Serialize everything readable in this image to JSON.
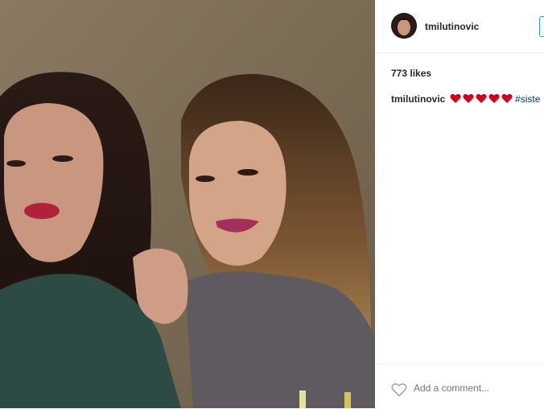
{
  "post": {
    "username": "tmilutinovic",
    "likes": "773 likes",
    "caption": {
      "username": "tmilutinovic",
      "emoji_count": 5,
      "emoji_icon": "red-heart-icon",
      "hashtag": "#siste"
    },
    "comment_placeholder": "Add a comment..."
  },
  "icons": {
    "like": "heart-outline-icon"
  },
  "colors": {
    "heart_red": "#d0021b",
    "link_blue": "#3897f0",
    "hashtag": "#003569"
  }
}
